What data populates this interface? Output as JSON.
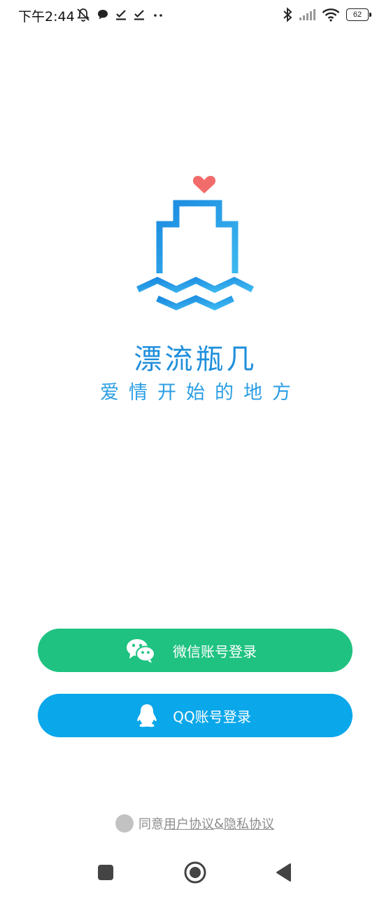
{
  "status_bar": {
    "time": "下午2:44",
    "battery": "62",
    "icons": [
      "mute-bell-icon",
      "chat-bubble-icon",
      "check-icon",
      "check-icon",
      "more-dots-icon",
      "bluetooth-icon",
      "signal-icon",
      "wifi-icon",
      "battery-icon"
    ]
  },
  "brand": {
    "app_name": "漂流瓶几",
    "tagline": "爱情开始的地方",
    "logo_icon": "boat-heart-logo",
    "logo_color": "#1f8fdc",
    "heart_color": "#f26b6b"
  },
  "buttons": {
    "wechat_label": "微信账号登录",
    "wechat_icon": "wechat-icon",
    "wechat_color": "#1fc281",
    "qq_label": "QQ账号登录",
    "qq_icon": "qq-penguin-icon",
    "qq_color": "#0aa7ea"
  },
  "agreement": {
    "prefix": "同意",
    "user_agreement": "用户协议",
    "separator": "&",
    "privacy_policy": "隐私协议"
  },
  "nav_bar": {
    "icons": [
      "recent-apps-icon",
      "home-icon",
      "back-icon"
    ]
  }
}
